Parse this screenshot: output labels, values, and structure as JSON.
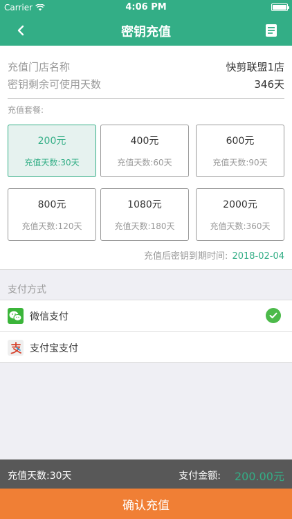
{
  "status_bar": {
    "carrier": "Carrier",
    "time": "4:06 PM",
    "battery_level": 1.0
  },
  "nav": {
    "title": "密钥充值",
    "back_icon": "chevron-left-icon",
    "right_icon": "document-list-icon"
  },
  "info": {
    "store_label": "充值门店名称",
    "store_value": "快剪联盟1店",
    "days_label": "密钥剩余可使用天数",
    "days_value": "346天"
  },
  "plans": {
    "label": "充值套餐:",
    "items": [
      {
        "price": "200元",
        "days": "充值天数:30天",
        "selected": true
      },
      {
        "price": "400元",
        "days": "充值天数:60天",
        "selected": false
      },
      {
        "price": "600元",
        "days": "充值天数:90天",
        "selected": false
      },
      {
        "price": "800元",
        "days": "充值天数:120天",
        "selected": false
      },
      {
        "price": "1080元",
        "days": "充值天数:180天",
        "selected": false
      },
      {
        "price": "2000元",
        "days": "充值天数:360天",
        "selected": false
      }
    ]
  },
  "expiry": {
    "label": "充值后密钥到期时间:",
    "date": "2018-02-04"
  },
  "payment": {
    "label": "支付方式",
    "methods": [
      {
        "name": "微信支付",
        "icon": "wechat-icon",
        "selected": true
      },
      {
        "name": "支付宝支付",
        "icon": "alipay-icon",
        "selected": false
      }
    ]
  },
  "summary": {
    "days_text": "充值天数:30天",
    "amount_label": "支付金额:",
    "amount_value": "200.00元"
  },
  "confirm_label": "确认充值",
  "colors": {
    "primary": "#33ae86",
    "accent": "#f07f35",
    "summary_bg": "#585858",
    "check": "#4cba4a"
  }
}
